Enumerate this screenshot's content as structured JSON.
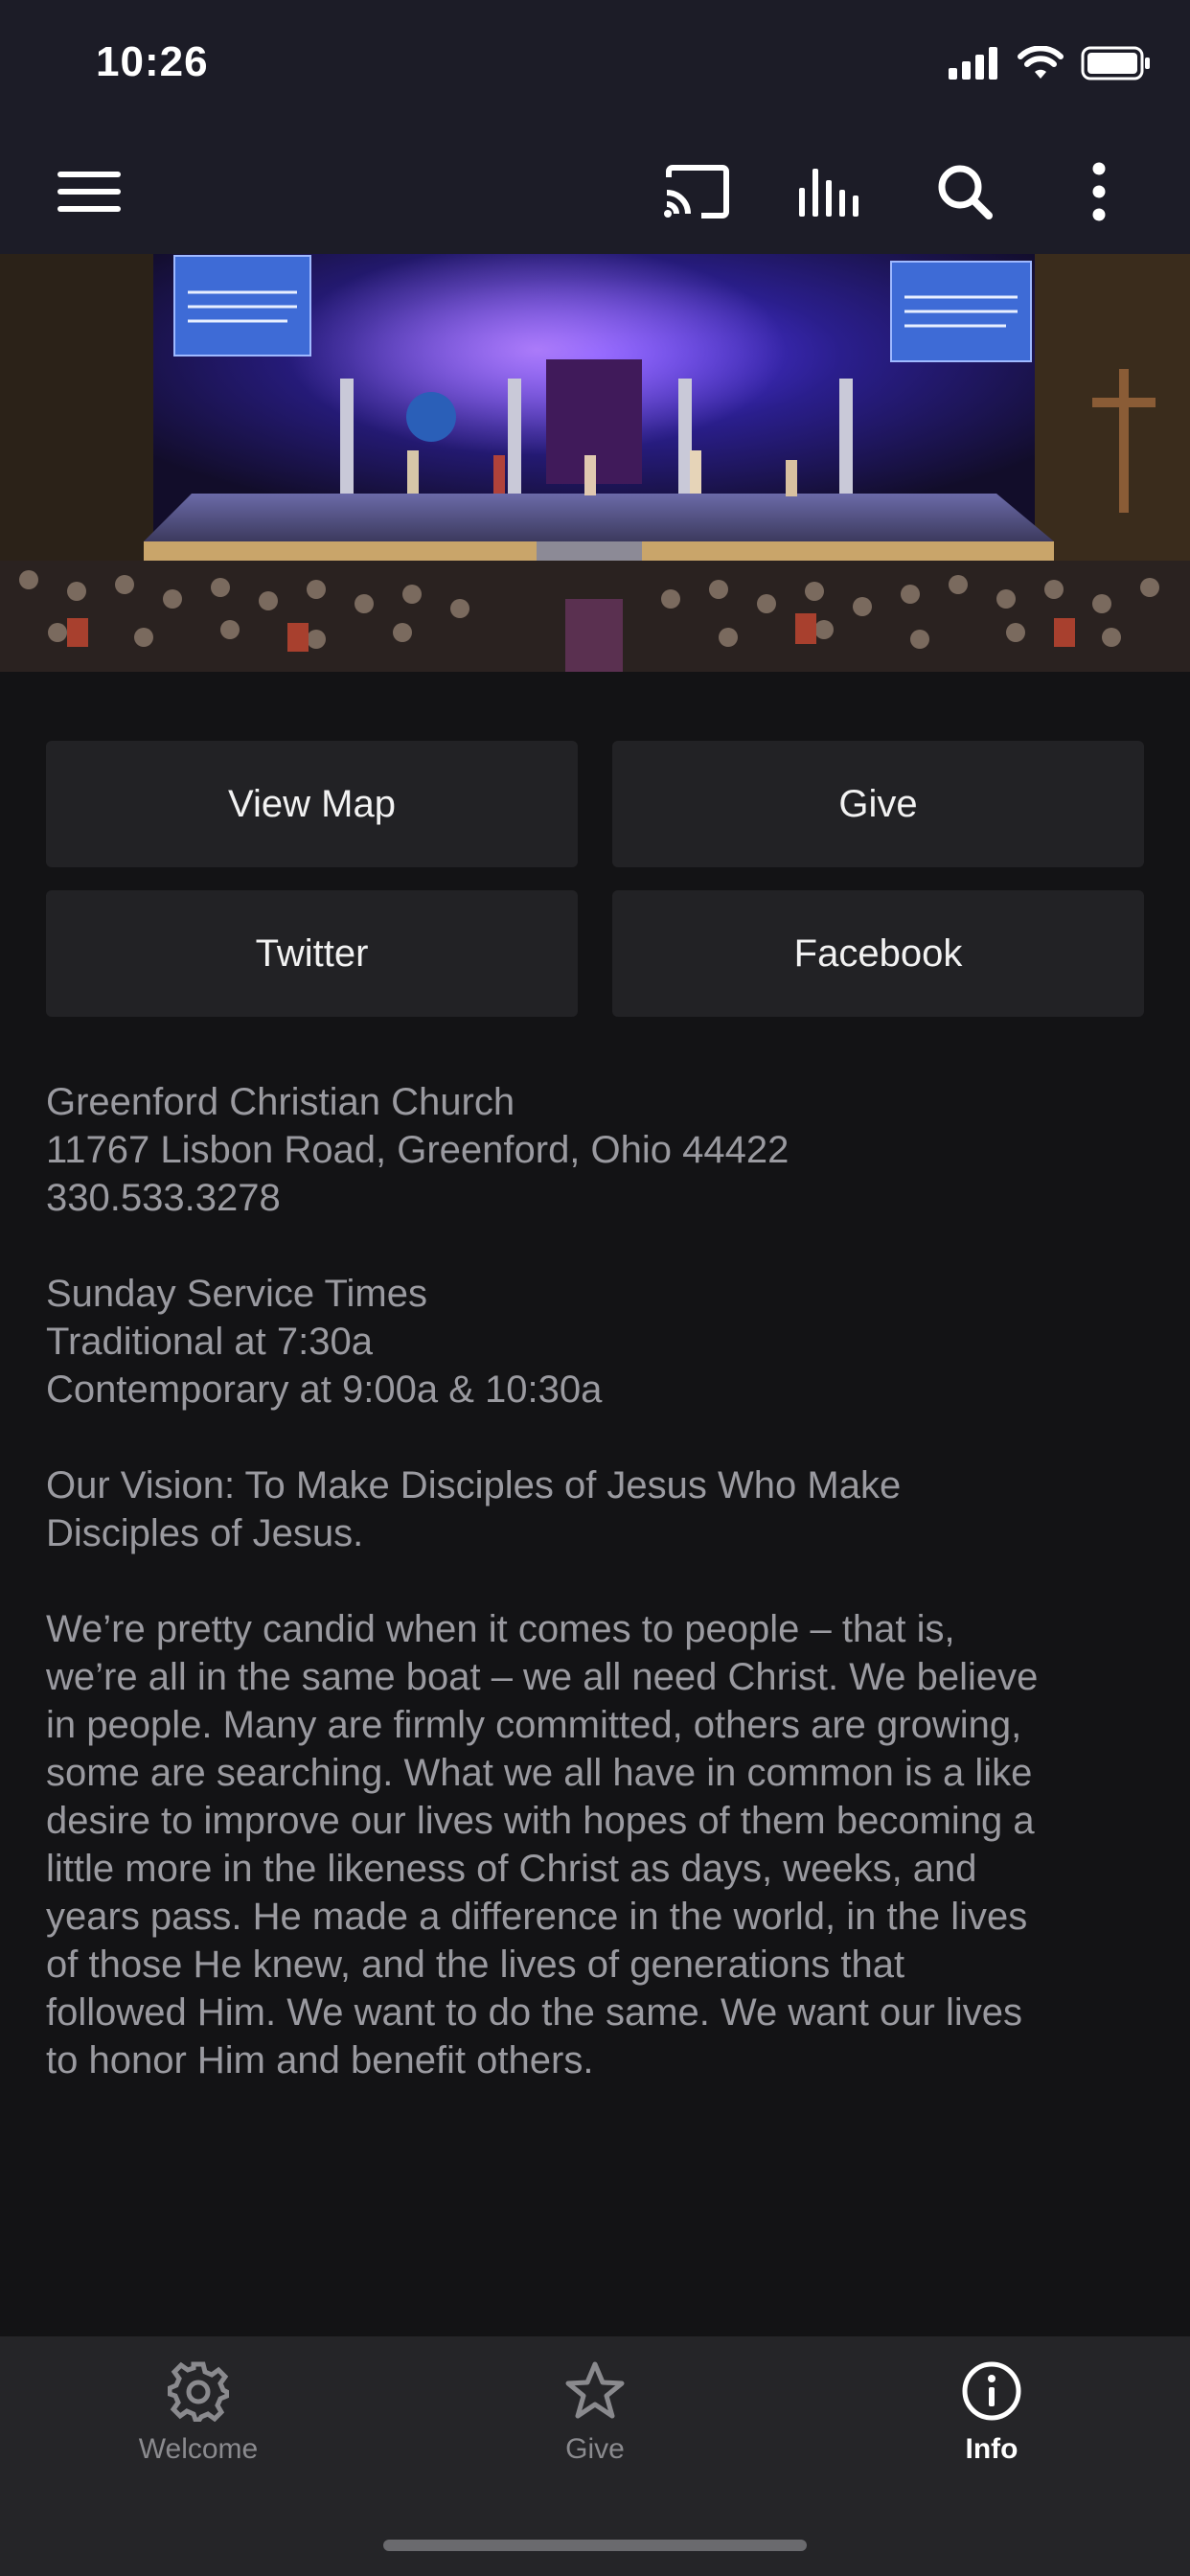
{
  "status_bar": {
    "time": "10:26"
  },
  "toolbar": {
    "icons": [
      "menu-icon",
      "cast-icon",
      "equalizer-icon",
      "search-icon",
      "more-vert-icon"
    ]
  },
  "hero_image": {
    "description": "church-sanctuary-worship"
  },
  "actions": [
    {
      "label": "View Map"
    },
    {
      "label": "Give"
    },
    {
      "label": "Twitter"
    },
    {
      "label": "Facebook"
    }
  ],
  "info": {
    "address_block": [
      "Greenford Christian Church",
      "11767 Lisbon Road, Greenford, Ohio  44422",
      "330.533.3278"
    ],
    "service_block": [
      "Sunday Service Times",
      "Traditional at 7:30a",
      "Contemporary at 9:00a & 10:30a"
    ],
    "vision_block": [
      "Our Vision: To Make Disciples of Jesus Who Make",
      "Disciples of Jesus."
    ],
    "about_block": [
      "We’re pretty candid when it comes to people – that is,",
      "we’re all in the same boat – we all need Christ. We believe",
      "in people. Many are firmly committed, others are growing,",
      "some are searching. What we all have in common is a like",
      "desire to improve our lives with hopes of them becoming a",
      "little more in the likeness of Christ as days, weeks, and",
      "years pass. He made a difference in the world, in the lives",
      "of those He knew, and the lives of generations that",
      "followed Him. We want to do the same. We want our lives",
      "to honor Him and benefit others."
    ]
  },
  "tabs": [
    {
      "label": "Welcome",
      "icon": "gear-icon",
      "active": false
    },
    {
      "label": "Give",
      "icon": "star-icon",
      "active": false
    },
    {
      "label": "Info",
      "icon": "info-icon",
      "active": true
    }
  ],
  "colors": {
    "background": "#131315",
    "header": "#1c1c27",
    "button": "#222225",
    "text_muted": "#9a9aa0",
    "tab_bar": "#252528"
  }
}
